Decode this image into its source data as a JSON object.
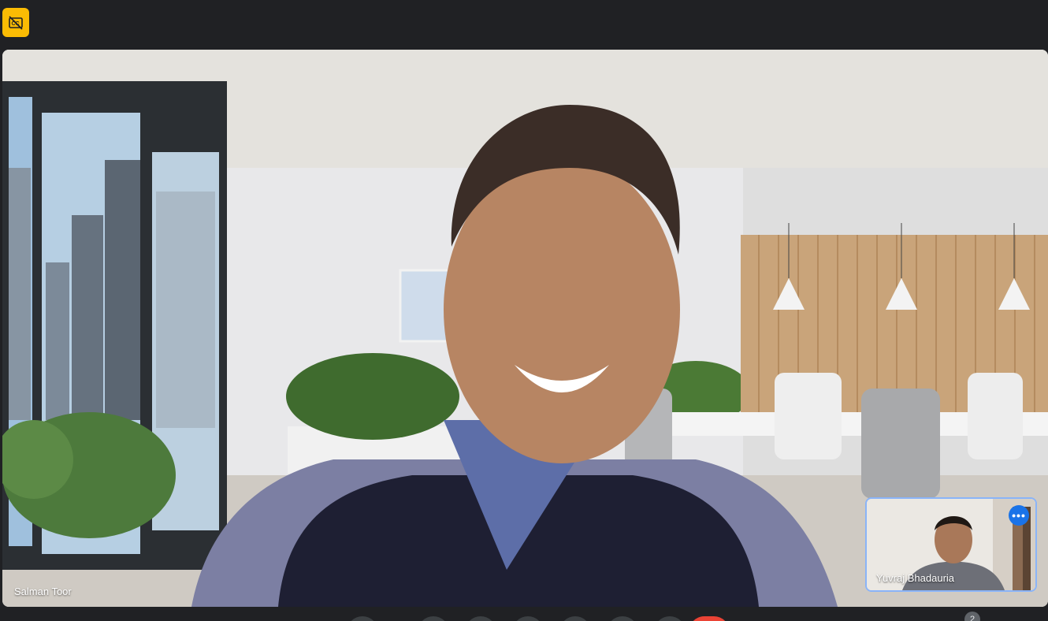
{
  "app": {
    "captions_badge_icon": "closed-captions-off-icon",
    "accent_color": "#fbbc04"
  },
  "main_tile": {
    "participant_name": "Salman Toor"
  },
  "self_tile": {
    "participant_name": "Yuvraj Bhadauria",
    "more_options_icon": "more-horiz-icon",
    "border_color": "#8ab4f8"
  },
  "controls": {
    "participant_count": "2",
    "end_call_color": "#ea4335"
  }
}
